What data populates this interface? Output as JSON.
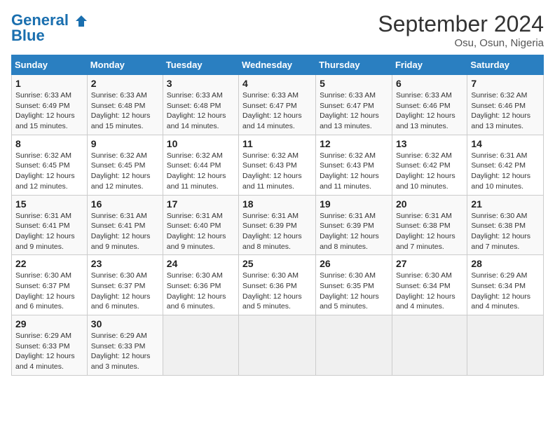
{
  "header": {
    "logo_line1": "General",
    "logo_line2": "Blue",
    "month": "September 2024",
    "location": "Osu, Osun, Nigeria"
  },
  "columns": [
    "Sunday",
    "Monday",
    "Tuesday",
    "Wednesday",
    "Thursday",
    "Friday",
    "Saturday"
  ],
  "weeks": [
    [
      {
        "day": "1",
        "info": "Sunrise: 6:33 AM\nSunset: 6:49 PM\nDaylight: 12 hours\nand 15 minutes."
      },
      {
        "day": "2",
        "info": "Sunrise: 6:33 AM\nSunset: 6:48 PM\nDaylight: 12 hours\nand 15 minutes."
      },
      {
        "day": "3",
        "info": "Sunrise: 6:33 AM\nSunset: 6:48 PM\nDaylight: 12 hours\nand 14 minutes."
      },
      {
        "day": "4",
        "info": "Sunrise: 6:33 AM\nSunset: 6:47 PM\nDaylight: 12 hours\nand 14 minutes."
      },
      {
        "day": "5",
        "info": "Sunrise: 6:33 AM\nSunset: 6:47 PM\nDaylight: 12 hours\nand 13 minutes."
      },
      {
        "day": "6",
        "info": "Sunrise: 6:33 AM\nSunset: 6:46 PM\nDaylight: 12 hours\nand 13 minutes."
      },
      {
        "day": "7",
        "info": "Sunrise: 6:32 AM\nSunset: 6:46 PM\nDaylight: 12 hours\nand 13 minutes."
      }
    ],
    [
      {
        "day": "8",
        "info": "Sunrise: 6:32 AM\nSunset: 6:45 PM\nDaylight: 12 hours\nand 12 minutes."
      },
      {
        "day": "9",
        "info": "Sunrise: 6:32 AM\nSunset: 6:45 PM\nDaylight: 12 hours\nand 12 minutes."
      },
      {
        "day": "10",
        "info": "Sunrise: 6:32 AM\nSunset: 6:44 PM\nDaylight: 12 hours\nand 11 minutes."
      },
      {
        "day": "11",
        "info": "Sunrise: 6:32 AM\nSunset: 6:43 PM\nDaylight: 12 hours\nand 11 minutes."
      },
      {
        "day": "12",
        "info": "Sunrise: 6:32 AM\nSunset: 6:43 PM\nDaylight: 12 hours\nand 11 minutes."
      },
      {
        "day": "13",
        "info": "Sunrise: 6:32 AM\nSunset: 6:42 PM\nDaylight: 12 hours\nand 10 minutes."
      },
      {
        "day": "14",
        "info": "Sunrise: 6:31 AM\nSunset: 6:42 PM\nDaylight: 12 hours\nand 10 minutes."
      }
    ],
    [
      {
        "day": "15",
        "info": "Sunrise: 6:31 AM\nSunset: 6:41 PM\nDaylight: 12 hours\nand 9 minutes."
      },
      {
        "day": "16",
        "info": "Sunrise: 6:31 AM\nSunset: 6:41 PM\nDaylight: 12 hours\nand 9 minutes."
      },
      {
        "day": "17",
        "info": "Sunrise: 6:31 AM\nSunset: 6:40 PM\nDaylight: 12 hours\nand 9 minutes."
      },
      {
        "day": "18",
        "info": "Sunrise: 6:31 AM\nSunset: 6:39 PM\nDaylight: 12 hours\nand 8 minutes."
      },
      {
        "day": "19",
        "info": "Sunrise: 6:31 AM\nSunset: 6:39 PM\nDaylight: 12 hours\nand 8 minutes."
      },
      {
        "day": "20",
        "info": "Sunrise: 6:31 AM\nSunset: 6:38 PM\nDaylight: 12 hours\nand 7 minutes."
      },
      {
        "day": "21",
        "info": "Sunrise: 6:30 AM\nSunset: 6:38 PM\nDaylight: 12 hours\nand 7 minutes."
      }
    ],
    [
      {
        "day": "22",
        "info": "Sunrise: 6:30 AM\nSunset: 6:37 PM\nDaylight: 12 hours\nand 6 minutes."
      },
      {
        "day": "23",
        "info": "Sunrise: 6:30 AM\nSunset: 6:37 PM\nDaylight: 12 hours\nand 6 minutes."
      },
      {
        "day": "24",
        "info": "Sunrise: 6:30 AM\nSunset: 6:36 PM\nDaylight: 12 hours\nand 6 minutes."
      },
      {
        "day": "25",
        "info": "Sunrise: 6:30 AM\nSunset: 6:36 PM\nDaylight: 12 hours\nand 5 minutes."
      },
      {
        "day": "26",
        "info": "Sunrise: 6:30 AM\nSunset: 6:35 PM\nDaylight: 12 hours\nand 5 minutes."
      },
      {
        "day": "27",
        "info": "Sunrise: 6:30 AM\nSunset: 6:34 PM\nDaylight: 12 hours\nand 4 minutes."
      },
      {
        "day": "28",
        "info": "Sunrise: 6:29 AM\nSunset: 6:34 PM\nDaylight: 12 hours\nand 4 minutes."
      }
    ],
    [
      {
        "day": "29",
        "info": "Sunrise: 6:29 AM\nSunset: 6:33 PM\nDaylight: 12 hours\nand 4 minutes."
      },
      {
        "day": "30",
        "info": "Sunrise: 6:29 AM\nSunset: 6:33 PM\nDaylight: 12 hours\nand 3 minutes."
      },
      {
        "day": "",
        "info": ""
      },
      {
        "day": "",
        "info": ""
      },
      {
        "day": "",
        "info": ""
      },
      {
        "day": "",
        "info": ""
      },
      {
        "day": "",
        "info": ""
      }
    ]
  ]
}
